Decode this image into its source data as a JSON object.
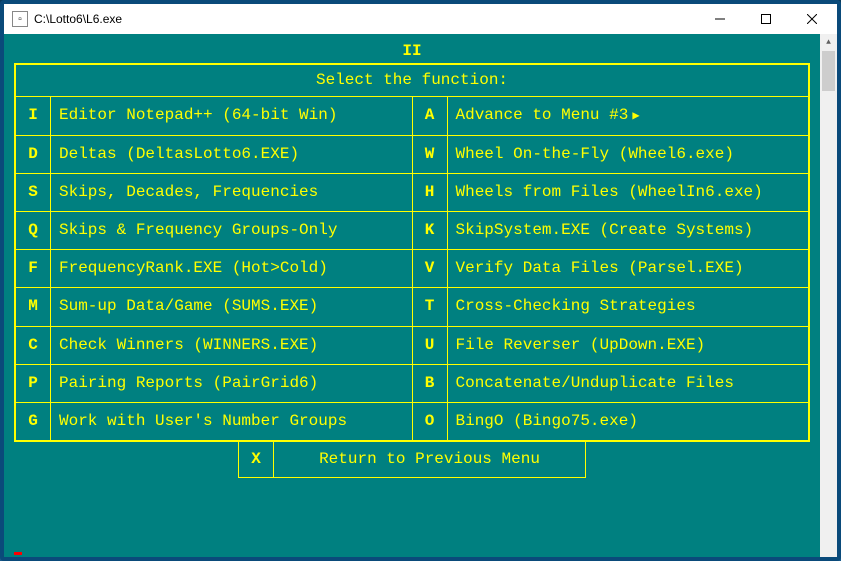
{
  "window": {
    "title": "C:\\Lotto6\\L6.exe"
  },
  "menu": {
    "title": "II",
    "header": "Select the function:",
    "left": [
      {
        "key": "I",
        "label": "Editor Notepad++ (64-bit Win)"
      },
      {
        "key": "D",
        "label": "Deltas (DeltasLotto6.EXE)"
      },
      {
        "key": "S",
        "label": "Skips, Decades, Frequencies"
      },
      {
        "key": "Q",
        "label": "Skips & Frequency Groups-Only"
      },
      {
        "key": "F",
        "label": "FrequencyRank.EXE (Hot>Cold)"
      },
      {
        "key": "M",
        "label": "Sum-up Data/Game (SUMS.EXE)"
      },
      {
        "key": "C",
        "label": "Check Winners (WINNERS.EXE)"
      },
      {
        "key": "P",
        "label": "Pairing Reports (PairGrid6)"
      },
      {
        "key": "G",
        "label": "Work with User's Number Groups"
      }
    ],
    "right": [
      {
        "key": "A",
        "label": "Advance to Menu #3",
        "arrow": true
      },
      {
        "key": "W",
        "label": "Wheel On-the-Fly (Wheel6.exe)"
      },
      {
        "key": "H",
        "label": "Wheels from Files (WheelIn6.exe)"
      },
      {
        "key": "K",
        "label": "SkipSystem.EXE (Create Systems)"
      },
      {
        "key": "V",
        "label": "Verify Data Files (Parsel.EXE)"
      },
      {
        "key": "T",
        "label": "Cross-Checking Strategies"
      },
      {
        "key": "U",
        "label": "File Reverser (UpDown.EXE)"
      },
      {
        "key": "B",
        "label": "Concatenate/Unduplicate Files"
      },
      {
        "key": "O",
        "label": "BingO (Bingo75.exe)"
      }
    ],
    "footer": {
      "key": "X",
      "label": "Return to Previous Menu"
    }
  }
}
